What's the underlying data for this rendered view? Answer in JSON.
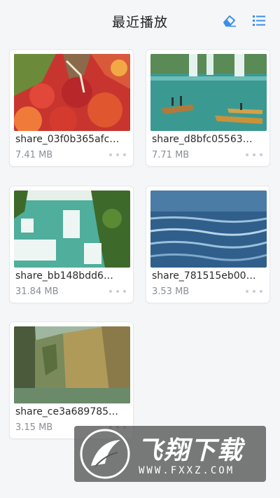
{
  "header": {
    "title": "最近播放",
    "clear_icon": "eraser-icon",
    "view_icon": "list-view-icon"
  },
  "videos": [
    {
      "name": "share_03f0b365afc…",
      "size": "7.41 MB"
    },
    {
      "name": "share_d8bfc05563…",
      "size": "7.71 MB"
    },
    {
      "name": "share_bb148bdd6…",
      "size": "31.84 MB"
    },
    {
      "name": "share_781515eb00…",
      "size": "3.53 MB"
    },
    {
      "name": "share_ce3a689785…",
      "size": "3.15 MB"
    }
  ],
  "watermark": {
    "text": "飞翔下载",
    "url": "WWW.FXXZ.COM"
  },
  "colors": {
    "accent": "#3b8fe8",
    "background": "#f5f6f8"
  }
}
